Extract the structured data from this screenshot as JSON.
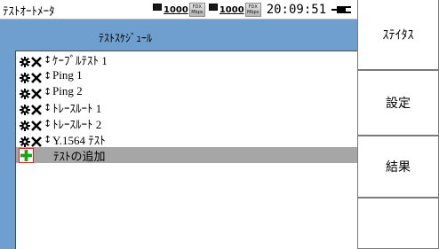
{
  "app": {
    "title": "ﾃｽﾄｵｰﾄﾒｰﾀ"
  },
  "status": {
    "port1": {
      "speed": "1000",
      "duplex_top": "FDX",
      "duplex_bottom": "Mbps"
    },
    "port2": {
      "speed": "1000",
      "duplex_top": "FDX",
      "duplex_bottom": "Mbps"
    },
    "time": "20:09:51"
  },
  "panel": {
    "title": "ﾃｽﾄｽｹｼﾞｭｰﾙ"
  },
  "tests": [
    {
      "label": "ｹｰﾌﾞﾙﾃｽﾄ 1"
    },
    {
      "label": "Ping 1"
    },
    {
      "label": "Ping 2"
    },
    {
      "label": "ﾄﾚｰｽﾙｰﾄ 1"
    },
    {
      "label": "ﾄﾚｰｽﾙｰﾄ 2"
    },
    {
      "label": "Y.1564 ﾃｽﾄ"
    }
  ],
  "add_item": {
    "label": "ﾃｽﾄの追加"
  },
  "side_buttons": {
    "status": "ｽﾃｲﾀｽ",
    "settings": "設定",
    "results": "結果",
    "empty": ""
  },
  "colors": {
    "background": "#6f9fcf",
    "selected_row": "#a6a6a6",
    "add_icon": "#1aa31a",
    "add_border": "#dd2222"
  },
  "icons": {
    "gear": "gear-icon",
    "delete": "cross-icon",
    "move": "updown-arrow-icon",
    "add": "plus-icon"
  }
}
